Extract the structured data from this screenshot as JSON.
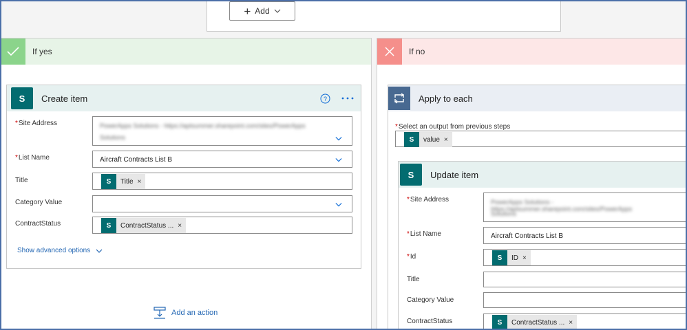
{
  "top": {
    "add_label": "Add"
  },
  "yes_branch": {
    "title": "If yes",
    "create_item": {
      "title": "Create item",
      "fields": {
        "site_address_label": "Site Address",
        "site_address_value_blurred_line1": "PowerApps Solutions - https://aptsummer.sharepoint.com/sites/PowerApps",
        "site_address_value_blurred_line2": "Solutions",
        "list_name_label": "List Name",
        "list_name_value": "Aircraft Contracts List B",
        "title_label": "Title",
        "title_token": "Title",
        "category_label": "Category Value",
        "contract_status_label": "ContractStatus",
        "contract_status_token": "ContractStatus ..."
      },
      "show_advanced": "Show advanced options"
    },
    "add_action": "Add an action"
  },
  "no_branch": {
    "title": "If no",
    "apply_to_each": {
      "title": "Apply to each",
      "select_label": "Select an output from previous steps",
      "value_token": "value"
    },
    "update_item": {
      "title": "Update item",
      "fields": {
        "site_address_label": "Site Address",
        "site_address_value_blurred_line1": "PowerApps Solutions - https://aptsummer.sharepoint.com/sites/PowerApps",
        "site_address_value_blurred_line2": "Solutions",
        "list_name_label": "List Name",
        "list_name_value": "Aircraft Contracts List B",
        "id_label": "Id",
        "id_token": "ID",
        "title_label": "Title",
        "category_label": "Category Value",
        "contract_status_label": "ContractStatus",
        "contract_status_token": "ContractStatus ..."
      }
    }
  },
  "icons": {
    "sharepoint": "S",
    "token_remove": "×"
  },
  "colors": {
    "yes_accent": "#8bd48b",
    "no_accent": "#f58f8b",
    "sharepoint": "#036c70",
    "loop": "#486991",
    "link": "#2266b3"
  }
}
